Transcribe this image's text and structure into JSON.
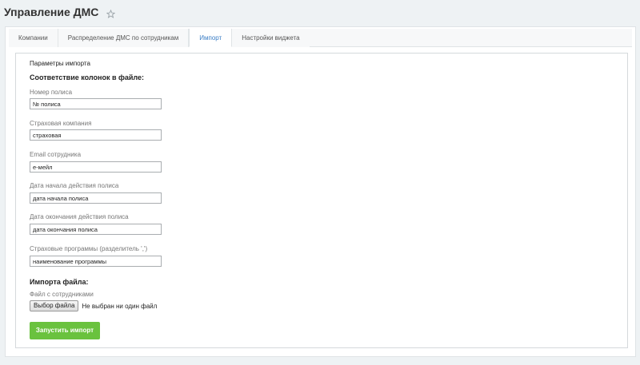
{
  "header": {
    "title": "Управление ДМС",
    "favorite_icon": "star-outline-icon"
  },
  "tabs": [
    {
      "label": "Компании",
      "active": false
    },
    {
      "label": "Распределение ДМС по сотрудникам",
      "active": false
    },
    {
      "label": "Импорт",
      "active": true
    },
    {
      "label": "Настройки виджета",
      "active": false
    }
  ],
  "import": {
    "caption": "Параметры импорта",
    "columns_heading": "Соответствие колонок в файле:",
    "fields": [
      {
        "label": "Номер полиса",
        "value": "№ полиса"
      },
      {
        "label": "Страховая компания",
        "value": "страховая"
      },
      {
        "label": "Email сотрудника",
        "value": "е-мейл"
      },
      {
        "label": "Дата начала действия полиса",
        "value": "дата начала полиса"
      },
      {
        "label": "Дата окончания действия полиса",
        "value": "дата окончания полиса"
      },
      {
        "label": "Страховые программы (разделитель ',')",
        "value": "наименование программы"
      }
    ],
    "file_heading": "Импорта файла:",
    "file_label": "Файл с сотрудниками",
    "file_button": "Выбор файла",
    "file_status": "Не выбран ни один файл",
    "submit_label": "Запустить импорт"
  },
  "colors": {
    "accent": "#3b7ec6",
    "submit": "#6ac23e",
    "background": "#eef2f4"
  }
}
